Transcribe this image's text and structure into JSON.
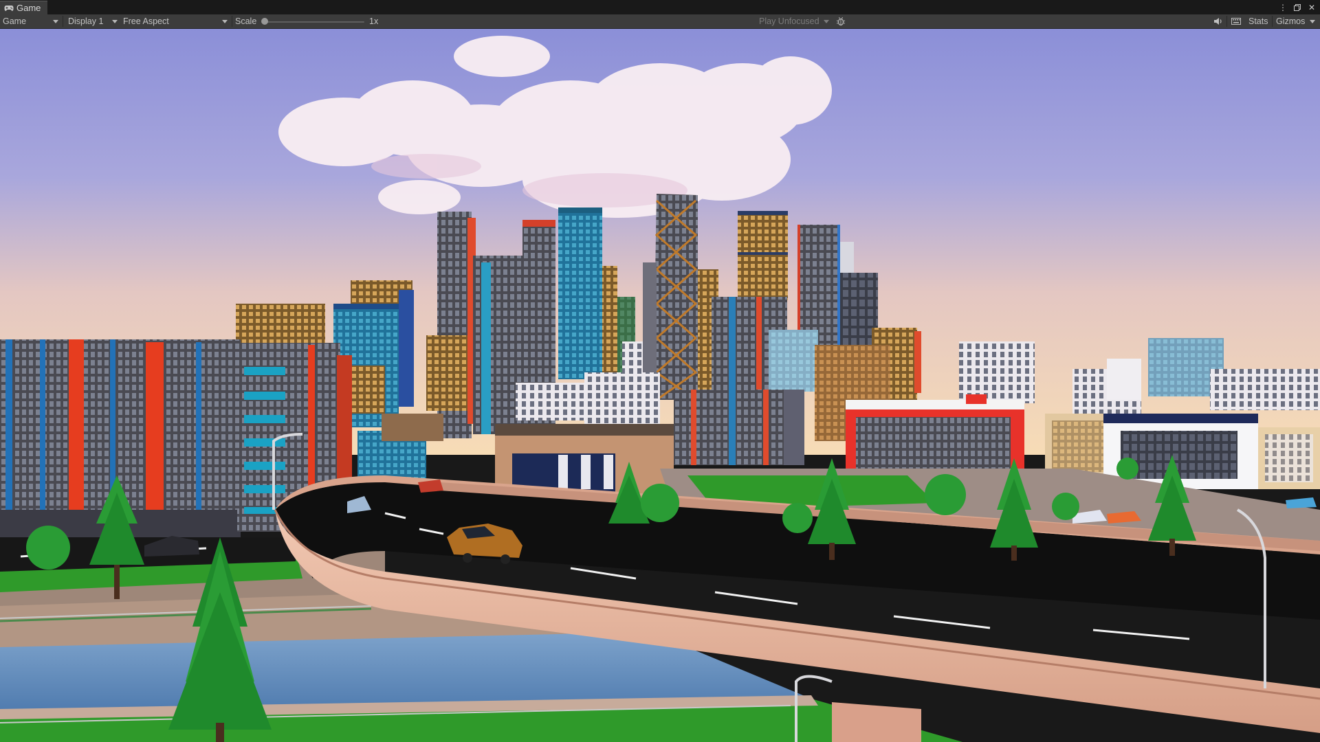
{
  "window": {
    "tab_title": "Game",
    "tab_icon": "gamepad-icon"
  },
  "toolbar": {
    "view_mode": "Game",
    "display": "Display 1",
    "aspect": "Free Aspect",
    "scale_label": "Scale",
    "scale_value": "1x",
    "scale_fraction": 0.0,
    "play_mode": "Play Unfocused",
    "stats_label": "Stats",
    "gizmos_label": "Gizmos"
  },
  "colors": {
    "editor_background": "#191919",
    "toolbar_background": "#3c3c3c",
    "toolbar_text": "#c4c4c4",
    "sky_top": "#8b8fd8",
    "sky_horizon": "#f1d6b8",
    "road": "#101010",
    "grass": "#2f9a2a",
    "water": "#5a86b8",
    "bridge": "#e8b9a2"
  },
  "viewport": {
    "scene": "low-poly city with elevated highway overpass"
  }
}
